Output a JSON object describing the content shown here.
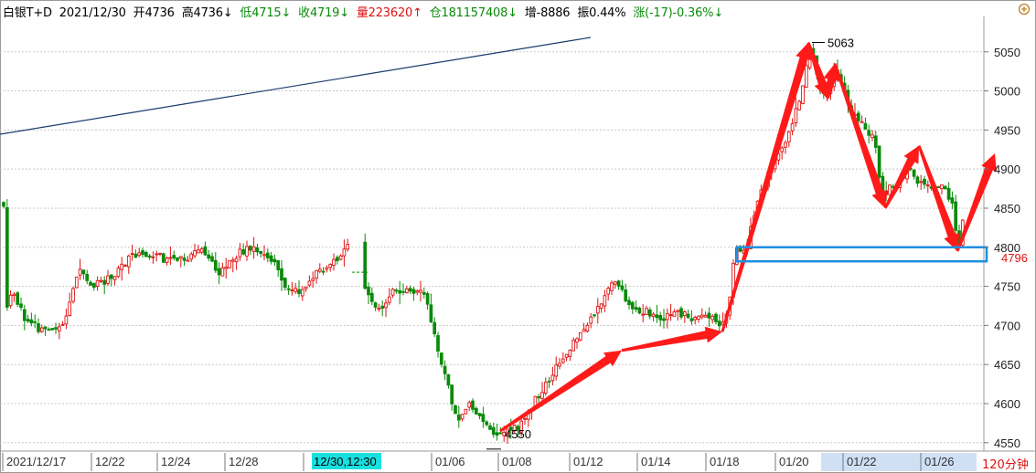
{
  "header": {
    "instrument": "白银T+D",
    "date": "2021/12/30",
    "open": "开4736",
    "high": "高4736↓",
    "low": "低4715↓",
    "close": "收4719↓",
    "volume": "量223620↑",
    "position": "仓181157408↓",
    "increase": "增-8886",
    "amplitude": "振0.44%",
    "change": "涨(-17)-0.36%↓"
  },
  "chart_data": {
    "type": "candlestick",
    "timeframe": "120分钟",
    "ylim": [
      4540,
      5090
    ],
    "y_ticks": [
      4550,
      4600,
      4650,
      4700,
      4750,
      4800,
      4850,
      4900,
      4950,
      5000,
      5050
    ],
    "x_tick_labels": [
      "2021/12/17",
      "12/22",
      "12/24",
      "12/28",
      "12/30,12:30",
      "01/06",
      "01/08",
      "01/12",
      "01/14",
      "01/18",
      "01/20",
      "01/22",
      "01/26"
    ],
    "cursor_time_label": "12/30,12:30",
    "annotations": {
      "high_label": "5063",
      "low_label": "4550",
      "price_label": "4796",
      "support_zone": [
        4782,
        4800
      ]
    },
    "swing_points": [
      4565,
      4668,
      4692,
      5062,
      4990,
      5035,
      4850,
      4930,
      4795,
      4920
    ],
    "colors": {
      "up": "#e01010",
      "down": "#0a8a0a",
      "arrows": "#ff1a1a",
      "zone": "#1e8fe0",
      "trendline": "#1a3a6a",
      "grid": "#c8c8c8"
    }
  }
}
